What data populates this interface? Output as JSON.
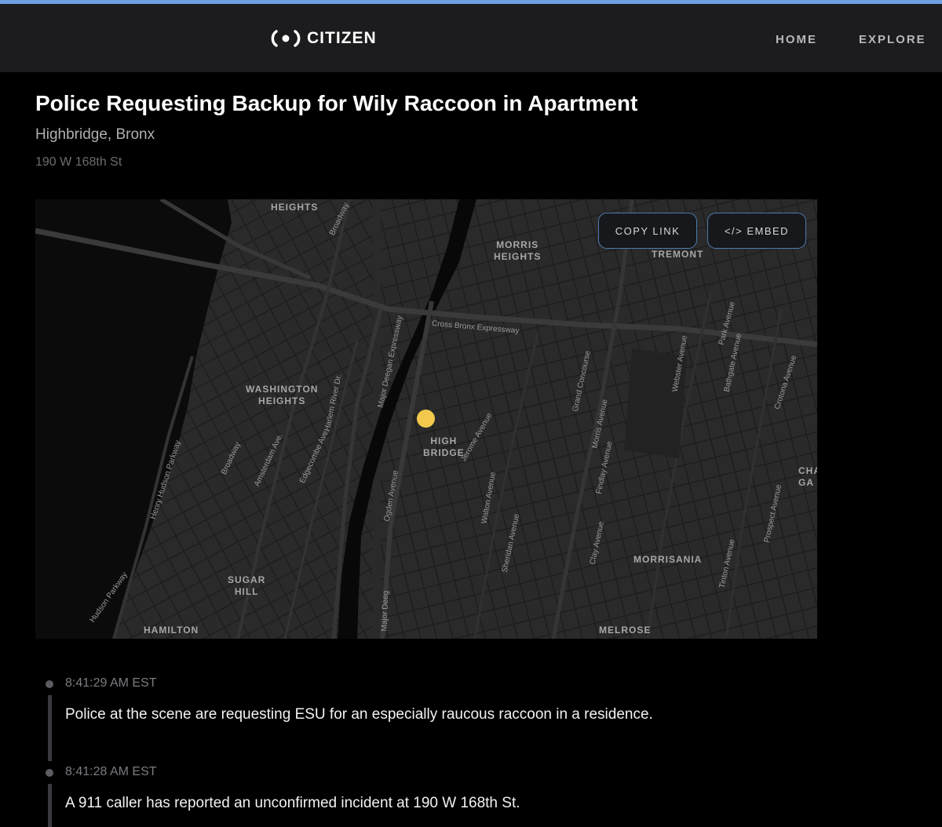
{
  "nav": {
    "logo_text": "CITIZEN",
    "home": "HOME",
    "explore": "EXPLORE"
  },
  "incident": {
    "title": "Police Requesting Backup for Wily Raccoon in Apartment",
    "neighborhood": "Highbridge, Bronx",
    "address": "190 W 168th St"
  },
  "map": {
    "copy_link": "COPY LINK",
    "embed": "</> EMBED",
    "areas": [
      "HEIGHTS",
      "MORRIS\nHEIGHTS",
      "TREMONT",
      "WASHINGTON\nHEIGHTS",
      "HIGH\nBRIDGE",
      "SUGAR\nHILL",
      "HAMILTON",
      "MORRISANIA",
      "MELROSE",
      "CHA\nGA"
    ],
    "streets": [
      "Cross Bronx Expressway",
      "Major Deegan Expressway",
      "Harlem River Dr.",
      "Broadway",
      "Broadway",
      "Amsterdam Ave.",
      "Edgecombe Ave.",
      "Henry Hudson Parkway",
      "Hudson Parkway",
      "Ogden Avenue",
      "Jerome Avenue",
      "Walton Avenue",
      "Sheridan Avenue",
      "Grand Concourse",
      "Morris Avenue",
      "Findlay Avenue",
      "Clay Avenue",
      "Webster Avenue",
      "Park Avenue",
      "Bathgate Avenue",
      "Crotona Avenue",
      "Tinton Avenue",
      "Prospect Avenue",
      "Major Deeg"
    ],
    "accent_color": "#f2c94c"
  },
  "updates": [
    {
      "time": "8:41:29 AM EST",
      "text": "Police at the scene are requesting ESU for an especially raucous raccoon in a residence."
    },
    {
      "time": "8:41:28 AM EST",
      "text": "A 911 caller has reported an unconfirmed incident at 190 W 168th St."
    }
  ]
}
